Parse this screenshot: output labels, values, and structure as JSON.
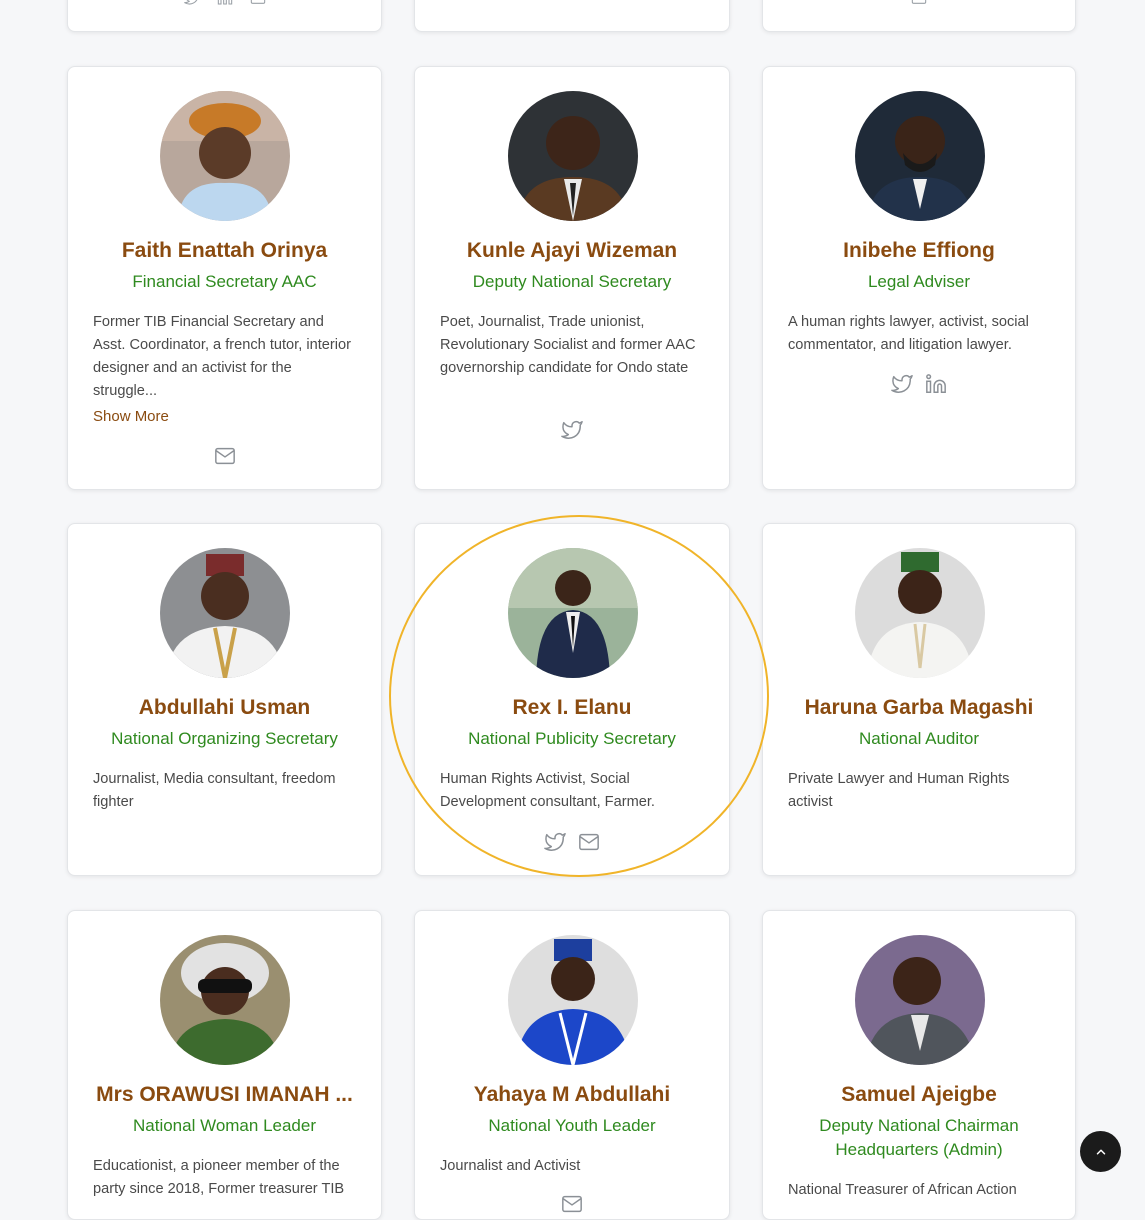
{
  "colors": {
    "name": "#8a4b10",
    "role": "#2f8a1f",
    "highlight": "#f0b429"
  },
  "cards": [
    {
      "name": "Faith Enattah Orinya",
      "role": "Financial Secretary AAC",
      "bio": "Former TIB Financial Secretary and Asst. Coordinator, a french tutor, interior designer and an activist for the struggle...",
      "show_more": "Show More",
      "icons": [
        "mail-icon"
      ]
    },
    {
      "name": "Kunle Ajayi Wizeman",
      "role": "Deputy National Secretary",
      "bio": "Poet, Journalist, Trade unionist, Revolutionary Socialist and former AAC governorship candidate for Ondo state",
      "icons": [
        "twitter-icon"
      ]
    },
    {
      "name": "Inibehe Effiong",
      "role": "Legal Adviser",
      "bio": "A human rights lawyer, activist, social commentator, and litigation lawyer.",
      "icons": [
        "twitter-icon",
        "linkedin-icon"
      ]
    },
    {
      "name": "Abdullahi Usman",
      "role": "National Organizing Secretary",
      "bio": "Journalist, Media consultant, freedom fighter",
      "icons": []
    },
    {
      "name": "Rex I. Elanu",
      "role": "National Publicity Secretary",
      "bio": "Human Rights Activist, Social Development consultant, Farmer.",
      "icons": [
        "twitter-icon",
        "mail-icon"
      ]
    },
    {
      "name": "Haruna Garba Magashi",
      "role": "National Auditor",
      "bio": "Private Lawyer and Human Rights activist",
      "icons": []
    },
    {
      "name": "Mrs ORAWUSI IMANAH ...",
      "role": "National Woman Leader",
      "bio": "Educationist, a pioneer member of the party since 2018, Former treasurer TIB",
      "icons": []
    },
    {
      "name": "Yahaya M Abdullahi",
      "role": "National Youth Leader",
      "bio": "Journalist and Activist",
      "icons": [
        "mail-icon"
      ]
    },
    {
      "name": "Samuel Ajeigbe",
      "role": "Deputy National Chairman Headquarters (Admin)",
      "bio": "National Treasurer of African Action",
      "icons": []
    }
  ],
  "top_partial_icons": [
    "twitter-icon",
    "linkedin-icon",
    "mail-icon",
    "mail-icon"
  ],
  "scroll_top_icon": "chevron-up-icon"
}
